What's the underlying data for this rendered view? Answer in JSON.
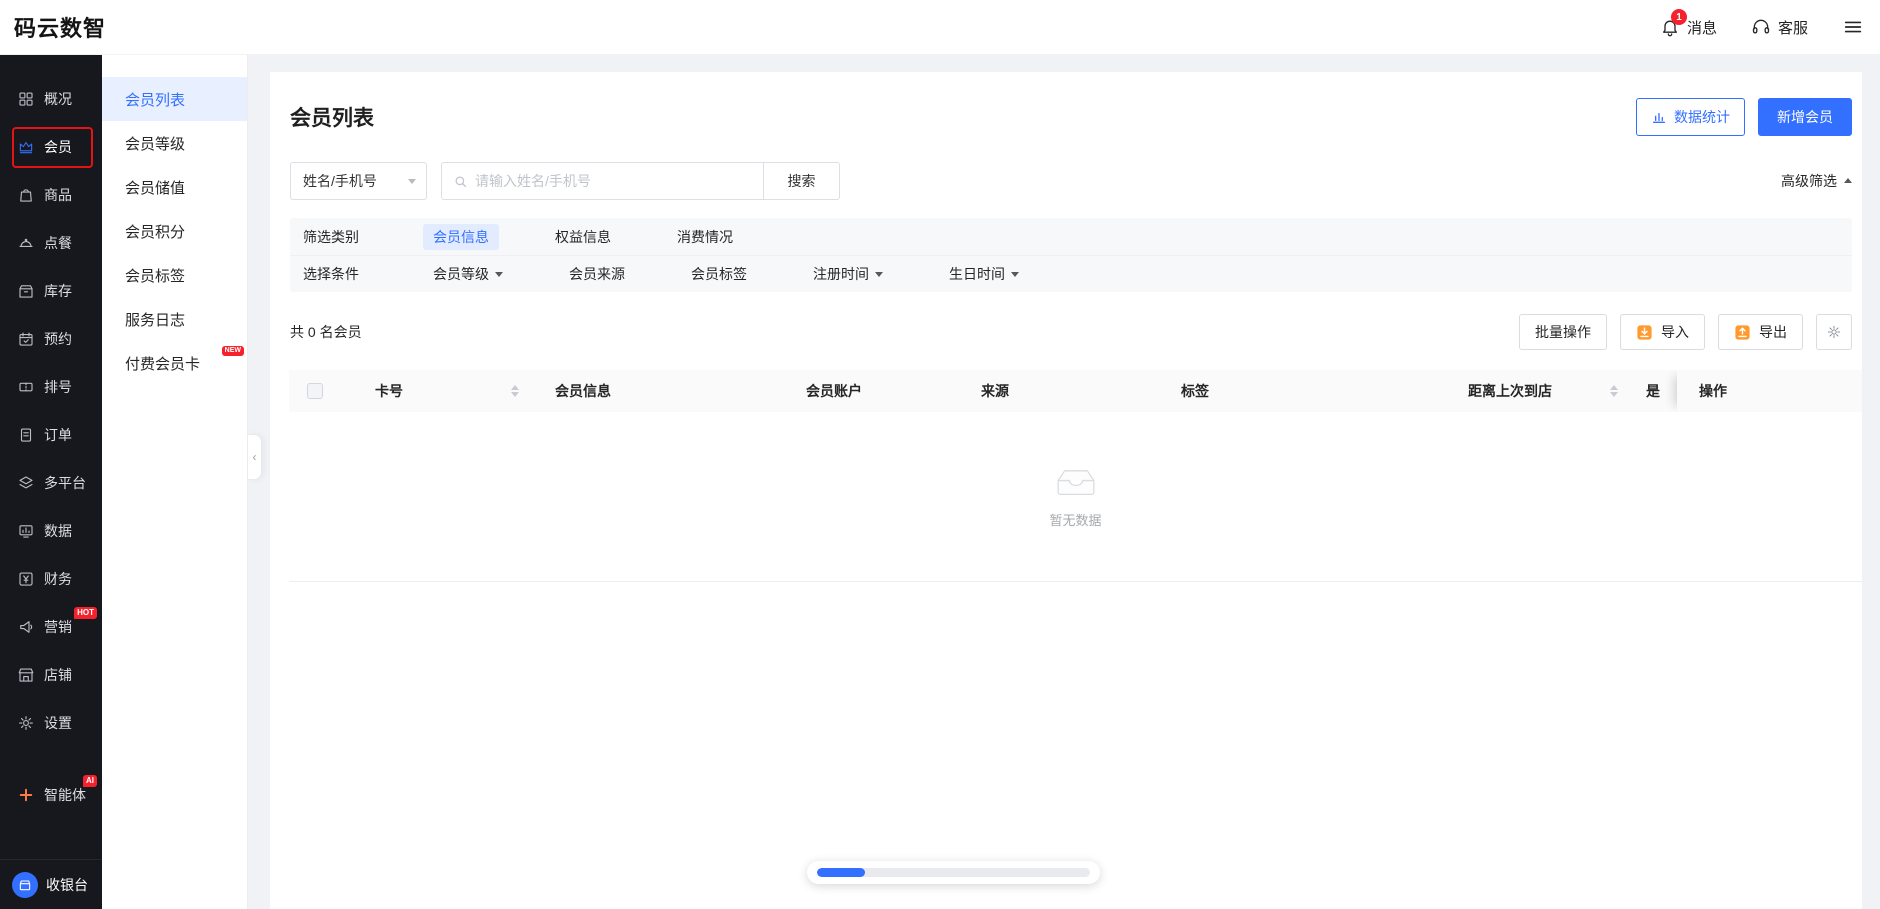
{
  "colors": {
    "primary": "#3370ff",
    "badge_red": "#f5222d",
    "icon_orange": "#ff9a2e"
  },
  "header": {
    "logo": "码云数智",
    "notification_count": "1",
    "messages": "消息",
    "support": "客服"
  },
  "sidebar": {
    "items": [
      {
        "label": "概况"
      },
      {
        "label": "会员"
      },
      {
        "label": "商品"
      },
      {
        "label": "点餐"
      },
      {
        "label": "库存"
      },
      {
        "label": "预约"
      },
      {
        "label": "排号"
      },
      {
        "label": "订单"
      },
      {
        "label": "多平台"
      },
      {
        "label": "数据"
      },
      {
        "label": "财务"
      },
      {
        "label": "营销",
        "badge": "HOT"
      },
      {
        "label": "店铺"
      },
      {
        "label": "设置"
      },
      {
        "label": "智能体",
        "badge": "AI"
      }
    ],
    "cashier": "收银台"
  },
  "submenu": {
    "items": [
      {
        "label": "会员列表"
      },
      {
        "label": "会员等级"
      },
      {
        "label": "会员储值"
      },
      {
        "label": "会员积分"
      },
      {
        "label": "会员标签"
      },
      {
        "label": "服务日志"
      },
      {
        "label": "付费会员卡",
        "badge": "NEW"
      }
    ]
  },
  "page": {
    "title": "会员列表",
    "stats_button": "数据统计",
    "add_button": "新增会员",
    "search": {
      "field": "姓名/手机号",
      "placeholder": "请输入姓名/手机号",
      "button": "搜索",
      "advanced": "高级筛选"
    },
    "filter": {
      "category_label": "筛选类别",
      "tabs": [
        "会员信息",
        "权益信息",
        "消费情况"
      ],
      "condition_label": "选择条件",
      "conditions": [
        "会员等级",
        "会员来源",
        "会员标签",
        "注册时间",
        "生日时间"
      ]
    },
    "toolbar": {
      "count": "共 0 名会员",
      "batch": "批量操作",
      "import": "导入",
      "export": "导出"
    },
    "table": {
      "columns": [
        "卡号",
        "会员信息",
        "会员账户",
        "来源",
        "标签",
        "距离上次到店",
        "是",
        "操作"
      ],
      "empty": "暂无数据"
    }
  }
}
